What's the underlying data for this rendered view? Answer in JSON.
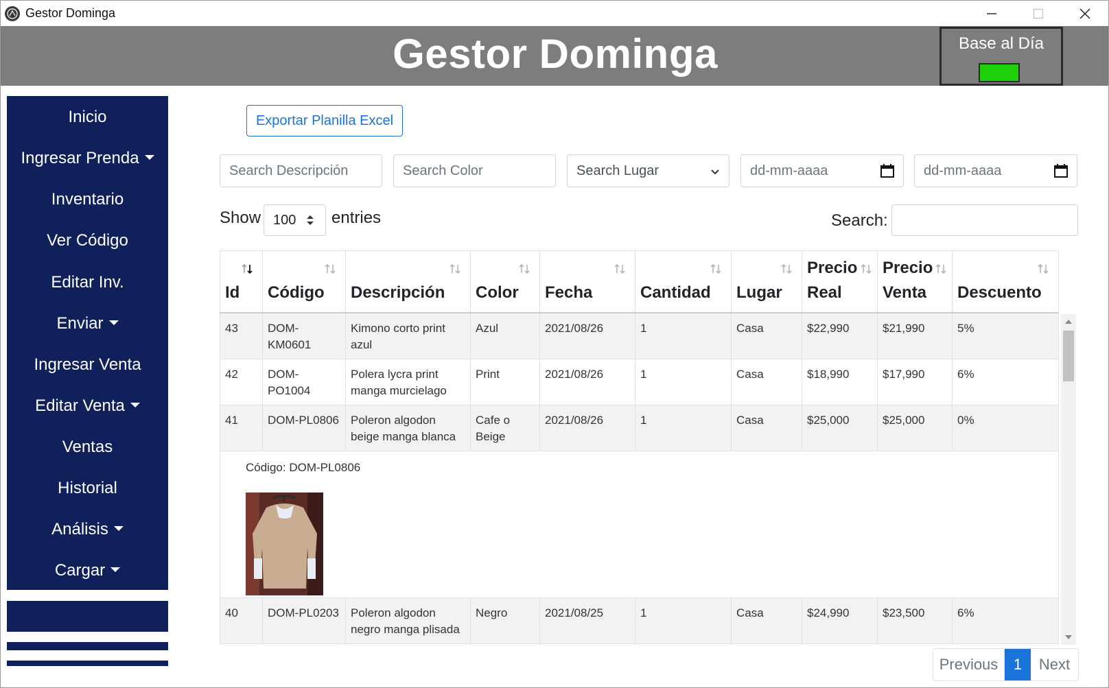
{
  "window": {
    "title": "Gestor Dominga"
  },
  "header": {
    "title": "Gestor Dominga",
    "status_label": "Base al Día",
    "status_color": "#1ed00a"
  },
  "sidebar": {
    "items": [
      {
        "label": "Inicio",
        "dropdown": false
      },
      {
        "label": "Ingresar Prenda",
        "dropdown": true
      },
      {
        "label": "Inventario",
        "dropdown": false
      },
      {
        "label": "Ver Código",
        "dropdown": false
      },
      {
        "label": "Editar Inv.",
        "dropdown": false
      },
      {
        "label": "Enviar",
        "dropdown": true
      },
      {
        "label": "Ingresar Venta",
        "dropdown": false
      },
      {
        "label": "Editar Venta",
        "dropdown": true
      },
      {
        "label": "Ventas",
        "dropdown": false
      },
      {
        "label": "Historial",
        "dropdown": false
      },
      {
        "label": "Análisis",
        "dropdown": true
      },
      {
        "label": "Cargar",
        "dropdown": true
      }
    ]
  },
  "toolbar": {
    "export_label": "Exportar Planilla Excel"
  },
  "filters": {
    "descripcion_placeholder": "Search Descripción",
    "color_placeholder": "Search Color",
    "lugar_selected": "Search Lugar",
    "date_from_placeholder": "dd-mm-aaaa",
    "date_to_placeholder": "dd-mm-aaaa"
  },
  "entries": {
    "show_label": "Show",
    "value": "100",
    "suffix": "entries",
    "search_label": "Search:"
  },
  "table": {
    "headers": [
      "Id",
      "Código",
      "Descripción",
      "Color",
      "Fecha",
      "Cantidad",
      "Lugar",
      "Precio Real",
      "Precio Venta",
      "Descuento"
    ],
    "rows": [
      [
        "43",
        "DOM-KM0601",
        "Kimono corto print azul",
        "Azul",
        "2021/08/26",
        "1",
        "Casa",
        "$22,990",
        "$21,990",
        "5%"
      ],
      [
        "42",
        "DOM-PO1004",
        "Polera lycra print manga murcielago",
        "Print",
        "2021/08/26",
        "1",
        "Casa",
        "$18,990",
        "$17,990",
        "6%"
      ],
      [
        "41",
        "DOM-PL0806",
        "Poleron algodon beige manga blanca",
        "Cafe o Beige",
        "2021/08/26",
        "1",
        "Casa",
        "$25,000",
        "$25,000",
        "0%"
      ],
      [
        "40",
        "DOM-PL0203",
        "Poleron algodon negro manga plisada",
        "Negro",
        "2021/08/25",
        "1",
        "Casa",
        "$24,990",
        "$23,500",
        "6%"
      ]
    ],
    "child_row": {
      "codigo_text": "Código: DOM-PL0806"
    }
  },
  "pagination": {
    "previous": "Previous",
    "current": "1",
    "next": "Next"
  }
}
